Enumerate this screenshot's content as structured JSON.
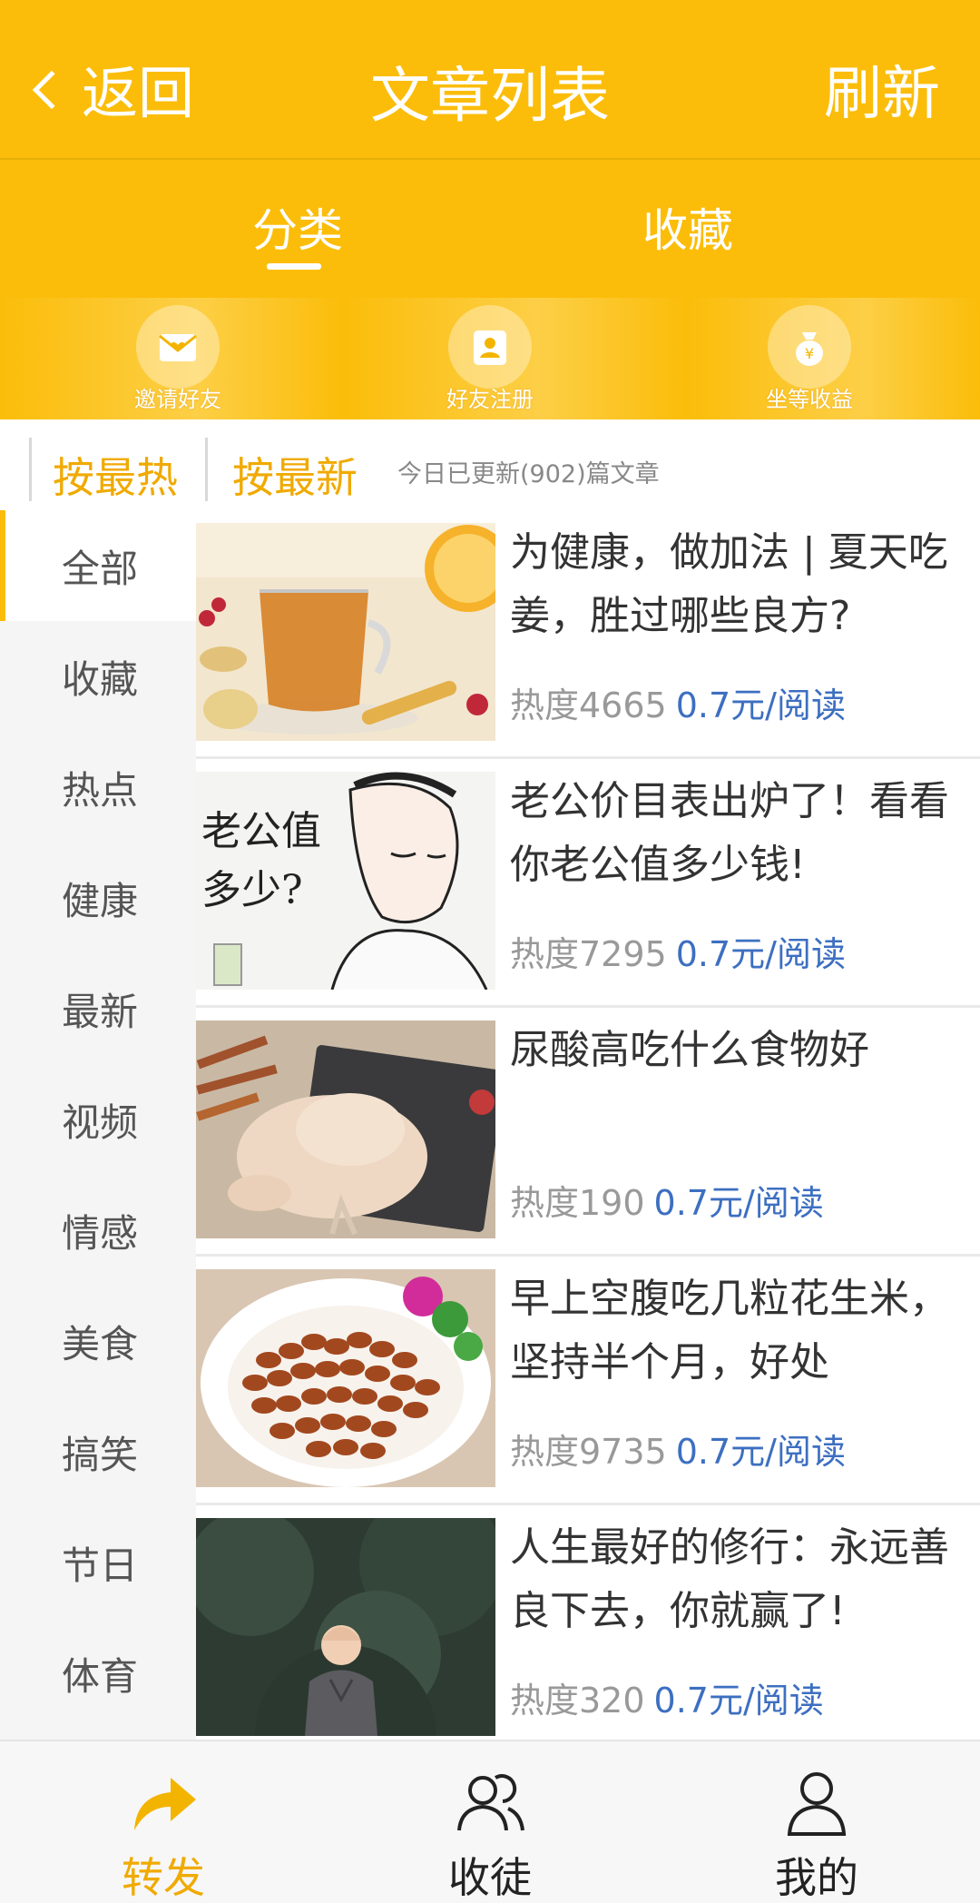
{
  "header": {
    "back_label": "返回",
    "title": "文章列表",
    "refresh_label": "刷新"
  },
  "tabs": [
    {
      "label": "分类",
      "active": true
    },
    {
      "label": "收藏",
      "active": false
    }
  ],
  "banner": [
    {
      "label": "邀请好友",
      "icon": "envelope-heart-icon"
    },
    {
      "label": "好友注册",
      "icon": "user-card-icon"
    },
    {
      "label": "坐等收益",
      "icon": "money-bag-icon"
    }
  ],
  "sort": {
    "hot_label": "按最热",
    "new_label": "按最新",
    "info": "今日已更新(902)篇文章"
  },
  "sidebar": {
    "items": [
      "全部",
      "收藏",
      "热点",
      "健康",
      "最新",
      "视频",
      "情感",
      "美食",
      "搞笑",
      "节日",
      "体育"
    ],
    "active_index": 0
  },
  "articles": [
    {
      "title": "为健康，做加法 | 夏天吃姜，胜过哪些良方?",
      "hot": "热度4665",
      "price": "0.7元/阅读",
      "thumb": "ginger-tea"
    },
    {
      "title": "老公价目表出炉了！看看你老公值多少钱!",
      "hot": "热度7295",
      "price": "0.7元/阅读",
      "thumb": "husband-drawing"
    },
    {
      "title": "尿酸高吃什么食物好",
      "hot": "热度190",
      "price": "0.7元/阅读",
      "thumb": "raw-chicken"
    },
    {
      "title": "早上空腹吃几粒花生米，坚持半个月，好处",
      "hot": "热度9735",
      "price": "0.7元/阅读",
      "thumb": "peanuts"
    },
    {
      "title": "人生最好的修行：永远善良下去，你就赢了!",
      "hot": "热度320",
      "price": "0.7元/阅读",
      "thumb": "child-monk"
    }
  ],
  "thumb_text": {
    "husband_caption_1": "老公值",
    "husband_caption_2": "多少?"
  },
  "bottom_nav": [
    {
      "label": "转发",
      "icon": "share-arrow-icon",
      "active": true
    },
    {
      "label": "收徒",
      "icon": "users-icon",
      "active": false
    },
    {
      "label": "我的",
      "icon": "user-icon",
      "active": false
    }
  ],
  "colors": {
    "primary": "#fbbd0a",
    "price": "#3d6fc1",
    "active_text": "#f0aa00"
  }
}
